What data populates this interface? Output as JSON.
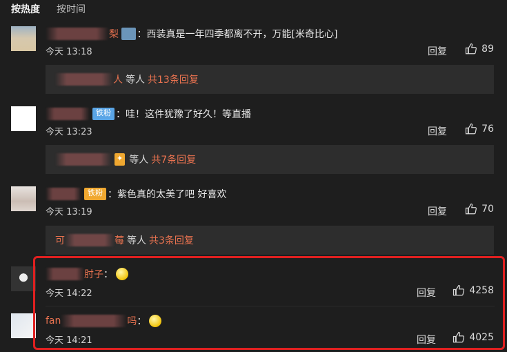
{
  "sort": {
    "hot": "按热度",
    "time": "按时间"
  },
  "reply_label": "回复",
  "time_prefix": "今天",
  "others_label": "等人",
  "comments": [
    {
      "name_visible": "梨",
      "text": "：西装真是一年四季都离不开，万能[米奇比心]",
      "time": "13:18",
      "likes": "89",
      "sub": {
        "name_visible": "人",
        "count": "共13条回复"
      }
    },
    {
      "badge": "铁粉",
      "text": "：哇！这件犹豫了好久！等直播",
      "time": "13:23",
      "likes": "76",
      "sub": {
        "name_visible": "",
        "count": "共7条回复"
      }
    },
    {
      "badge": "铁粉",
      "text": "：紫色真的太美了吧 好喜欢",
      "time": "13:19",
      "likes": "70",
      "sub": {
        "name_prefix": "可",
        "name_visible": "莓",
        "count": "共3条回复"
      }
    },
    {
      "name_visible": "肘子",
      "text": "：",
      "time": "14:22",
      "likes": "4258"
    },
    {
      "name_prefix": "fan",
      "name_visible": "吗",
      "text": "：",
      "time": "14:21",
      "likes": "4025"
    }
  ]
}
